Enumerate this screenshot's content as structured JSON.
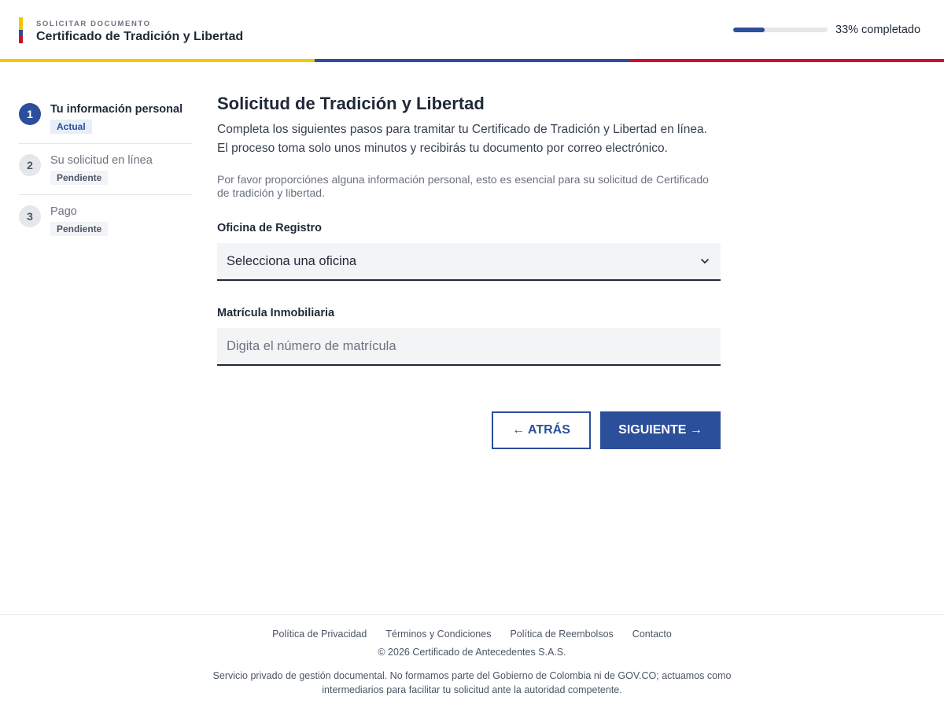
{
  "header": {
    "eyebrow": "SOLICITAR DOCUMENTO",
    "title": "Certificado de Tradición y Libertad",
    "progress_value": 0.33,
    "progress_label": "33% completado",
    "flag_colors": [
      "#f7c600",
      "#2b4f9a",
      "#c8102e"
    ]
  },
  "steps": [
    {
      "number": "1",
      "title": "Tu información personal",
      "status": "Actual",
      "state": "active"
    },
    {
      "number": "2",
      "title": "Su solicitud en línea",
      "status": "Pendiente",
      "state": "pending"
    },
    {
      "number": "3",
      "title": "Pago",
      "status": "Pendiente",
      "state": "pending"
    }
  ],
  "main": {
    "title": "Solicitud de Tradición y Libertad",
    "intro": "Completa los siguientes pasos para tramitar tu Certificado de Tradición y Libertad en línea. El proceso toma solo unos minutos y recibirás tu documento por correo electrónico.",
    "note": "Por favor proporciónes alguna información personal, esto es esencial para su solicitud de Certificado de tradición y libertad.",
    "office": {
      "label": "Oficina de Registro",
      "selected": "Selecciona una oficina",
      "icon": "chevron-down-icon"
    },
    "matricula": {
      "label": "Matrícula Inmobiliaria",
      "placeholder": "Digita el número de matrícula",
      "value": ""
    },
    "back_label": "← ATRÁS",
    "next_label": "SIGUIENTE →"
  },
  "footer": {
    "links": [
      "Política de Privacidad",
      "Términos y Condiciones",
      "Política de Reembolsos",
      "Contacto"
    ],
    "copyright": "© 2026 Certificado de Antecedentes S.A.S.",
    "disclaimer": "Servicio privado de gestión documental. No formamos parte del Gobierno de Colombia ni de GOV.CO; actuamos como intermediarios para facilitar tu solicitud ante la autoridad competente."
  },
  "colors": {
    "accent": "#2b4f9a",
    "field_bg": "#f3f4f6",
    "text": "#1f2937"
  }
}
